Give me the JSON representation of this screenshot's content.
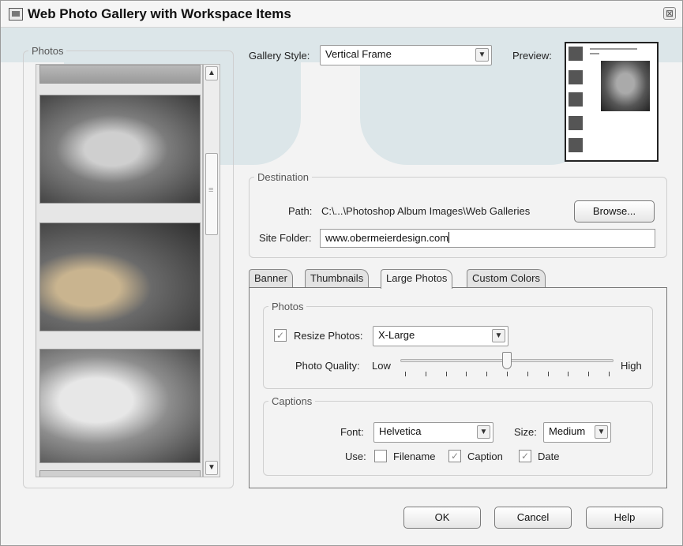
{
  "window": {
    "title": "Web Photo Gallery with Workspace Items",
    "close_glyph": "⊠"
  },
  "photos_panel": {
    "legend": "Photos",
    "scroll_up_glyph": "▲",
    "scroll_down_glyph": "▼"
  },
  "gallery": {
    "style_label": "Gallery Style:",
    "style_value": "Vertical Frame",
    "preview_label": "Preview:"
  },
  "destination": {
    "legend": "Destination",
    "path_label": "Path:",
    "path_value": "C:\\...\\Photoshop Album Images\\Web Galleries",
    "browse_label": "Browse...",
    "site_folder_label": "Site Folder:",
    "site_folder_value": "www.obermeierdesign.com"
  },
  "tabs": [
    {
      "label": "Banner",
      "active": false
    },
    {
      "label": "Thumbnails",
      "active": false
    },
    {
      "label": "Large Photos",
      "active": true
    },
    {
      "label": "Custom Colors",
      "active": false
    }
  ],
  "large_photos": {
    "photos_legend": "Photos",
    "resize_label": "Resize Photos:",
    "resize_checked": true,
    "resize_value": "X-Large",
    "quality_label": "Photo Quality:",
    "quality_low": "Low",
    "quality_high": "High",
    "quality_level": 0.5,
    "captions_legend": "Captions",
    "font_label": "Font:",
    "font_value": "Helvetica",
    "size_label": "Size:",
    "size_value": "Medium",
    "use_label": "Use:",
    "use_options": [
      {
        "label": "Filename",
        "checked": false
      },
      {
        "label": "Caption",
        "checked": true
      },
      {
        "label": "Date",
        "checked": true
      }
    ]
  },
  "footer": {
    "ok_label": "OK",
    "cancel_label": "Cancel",
    "help_label": "Help"
  },
  "icons": {
    "check_glyph": "✓",
    "dropdown_glyph": "▼"
  }
}
